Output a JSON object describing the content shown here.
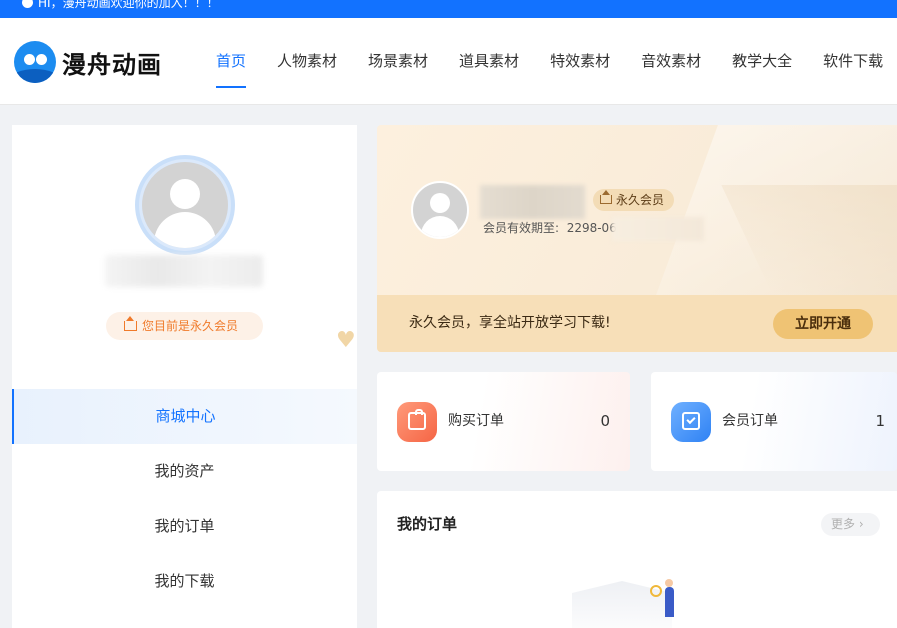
{
  "topbar": {
    "greeting": "HI，漫舟动画欢迎你的加入！！！"
  },
  "header": {
    "logo_text": "漫舟动画",
    "nav": [
      {
        "label": "首页",
        "active": true
      },
      {
        "label": "人物素材"
      },
      {
        "label": "场景素材"
      },
      {
        "label": "道具素材"
      },
      {
        "label": "特效素材"
      },
      {
        "label": "音效素材"
      },
      {
        "label": "教学大全"
      },
      {
        "label": "软件下载"
      }
    ]
  },
  "sidebar": {
    "vip_status": "您目前是永久会员",
    "menu": [
      {
        "label": "商城中心",
        "active": true
      },
      {
        "label": "我的资产"
      },
      {
        "label": "我的订单"
      },
      {
        "label": "我的下载"
      }
    ]
  },
  "vip_card": {
    "tag": "永久会员",
    "expire_label": "会员有效期至:",
    "expire_value": "2298-06",
    "bar_message": "永久会员，享全站开放学习下载!",
    "open_button": "立即开通"
  },
  "order_stats": [
    {
      "label": "购买订单",
      "count": "0"
    },
    {
      "label": "会员订单",
      "count": "1"
    }
  ],
  "my_orders": {
    "title": "我的订单",
    "more": "更多 ›"
  },
  "colors": {
    "primary": "#1272ff",
    "vip_gold": "#efc374",
    "vip_badge_text": "#f07a2a"
  }
}
